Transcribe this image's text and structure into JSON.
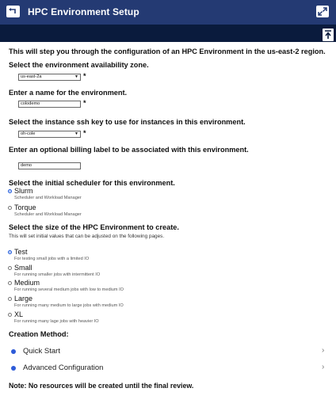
{
  "header": {
    "title": "HPC Environment Setup",
    "back_icon": "back-arrow-icon",
    "expand_icon": "expand-icon"
  },
  "toolbar": {
    "upload_icon": "upload-icon"
  },
  "intro": "This will step you through the configuration of an HPC Environment in the us-east-2 region.",
  "zone": {
    "question": "Select the environment availability zone.",
    "value": "us-east-2a",
    "required": "*"
  },
  "name": {
    "question": "Enter a name for the environment.",
    "value": "colodemo",
    "required": "*"
  },
  "sshkey": {
    "question": "Select the instance ssh key to use for instances in this environment.",
    "value": "oh-cole",
    "required": "*"
  },
  "billing": {
    "question": "Enter an optional billing label to be associated with this environment.",
    "value": "demo"
  },
  "scheduler": {
    "question": "Select the initial scheduler for this environment.",
    "options": [
      {
        "label": "Slurm",
        "desc": "Scheduler and Workload Manager",
        "selected": true
      },
      {
        "label": "Torque",
        "desc": "Scheduler and Workload Manager",
        "selected": false
      }
    ]
  },
  "size": {
    "question": "Select the size of the HPC Environment to create.",
    "note": "This will set initial values that can be adjusted on the following pages.",
    "options": [
      {
        "label": "Test",
        "desc": "For testing small jobs with a limited IO",
        "selected": true
      },
      {
        "label": "Small",
        "desc": "For running smaller jobs with intermittent IO",
        "selected": false
      },
      {
        "label": "Medium",
        "desc": "For running several medium jobs with low to medium IO",
        "selected": false
      },
      {
        "label": "Large",
        "desc": "For running many medium to large jobs with medium IO",
        "selected": false
      },
      {
        "label": "XL",
        "desc": "For running many lage jobs with heavier IO",
        "selected": false
      }
    ]
  },
  "creation": {
    "title": "Creation Method:",
    "methods": [
      {
        "label": "Quick Start",
        "chevron": "›"
      },
      {
        "label": "Advanced Configuration",
        "chevron": "›"
      }
    ]
  },
  "footer_note": "Note: No resources will be created until the final review.",
  "colors": {
    "header": "#243a73",
    "subbar": "#0a1b3d",
    "accent": "#2e5bd8"
  }
}
